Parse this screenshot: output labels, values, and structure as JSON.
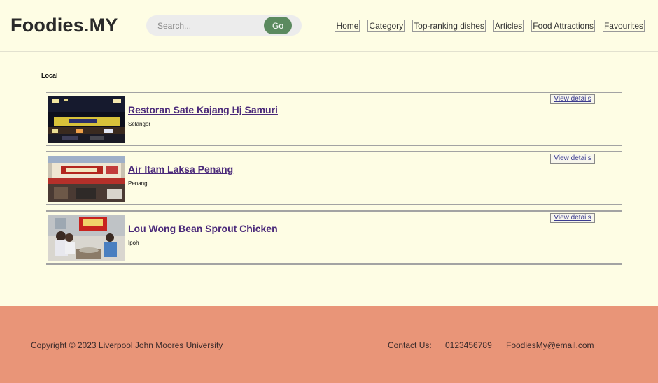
{
  "header": {
    "logo": "Foodies.MY",
    "search": {
      "placeholder": "Search...",
      "button": "Go"
    },
    "nav": [
      "Home",
      "Category",
      "Top-ranking dishes",
      "Articles",
      "Food Attractions",
      "Favourites"
    ]
  },
  "section": {
    "title": "Local"
  },
  "restaurants": [
    {
      "name": "Restoran Sate Kajang Hj Samuri",
      "location": "Selangor",
      "button": "View details",
      "thumb_icon": "night-storefront-photo"
    },
    {
      "name": "Air Itam Laksa Penang",
      "location": "Penang",
      "button": "View details",
      "thumb_icon": "lou-wong-storefront-photo"
    },
    {
      "name": "Lou Wong Bean Sprout Chicken",
      "location": "Ipoh",
      "button": "View details",
      "thumb_icon": "laksa-stall-photo"
    }
  ],
  "footer": {
    "copyright": "Copyright © 2023 Liverpool John Moores University",
    "contact_label": "Contact Us:",
    "phone": "0123456789",
    "email": "FoodiesMy@email.com"
  },
  "colors": {
    "background": "#fefde4",
    "footer": "#e99578",
    "go_button": "#5b8a5f",
    "link": "#4b2a7a"
  }
}
